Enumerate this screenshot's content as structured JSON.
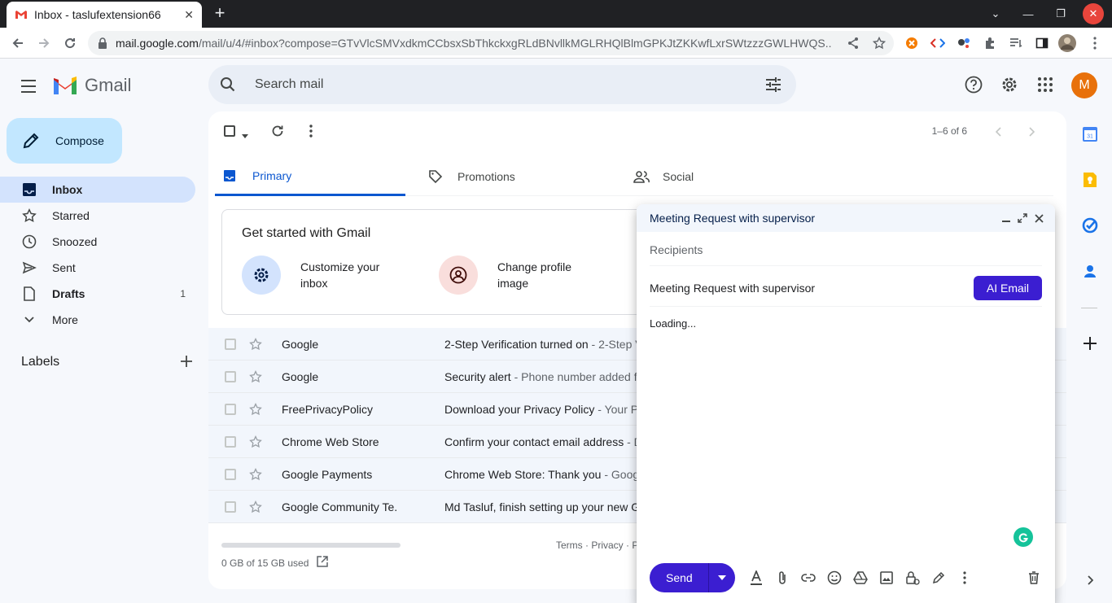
{
  "browser": {
    "tab_title": "Inbox - taslufextension66",
    "url_host": "mail.google.com",
    "url_path": "/mail/u/4/#inbox?compose=GTvVlcSMVxdkmCCbsxSbThkckxgRLdBNvllkMGLRHQlBlmGPKJtZKKwfLxrSWtzzzGWLHWQS..."
  },
  "gmail": {
    "brand": "Gmail",
    "search_placeholder": "Search mail",
    "avatar_letter": "M",
    "compose_label": "Compose"
  },
  "nav": {
    "items": [
      {
        "label": "Inbox",
        "count": ""
      },
      {
        "label": "Starred",
        "count": ""
      },
      {
        "label": "Snoozed",
        "count": ""
      },
      {
        "label": "Sent",
        "count": ""
      },
      {
        "label": "Drafts",
        "count": "1"
      },
      {
        "label": "More",
        "count": ""
      }
    ],
    "labels_heading": "Labels"
  },
  "main": {
    "pager": "1–6 of 6",
    "tabs": [
      "Primary",
      "Promotions",
      "Social"
    ],
    "get_started": {
      "title": "Get started with Gmail",
      "items": [
        "Customize your inbox",
        "Change profile image"
      ]
    },
    "emails": [
      {
        "sender": "Google",
        "subject": "2-Step Verification turned on",
        "snippet": " - 2-Step V"
      },
      {
        "sender": "Google",
        "subject": "Security alert",
        "snippet": " - Phone number added fo"
      },
      {
        "sender": "FreePrivacyPolicy",
        "subject": "Download your Privacy Policy",
        "snippet": " - Your Priv"
      },
      {
        "sender": "Chrome Web Store",
        "subject": "Confirm your contact email address",
        "snippet": " - D"
      },
      {
        "sender": "Google Payments",
        "subject": "Chrome Web Store: Thank you",
        "snippet": " - Google"
      },
      {
        "sender": "Google Community Te.",
        "subject": "Md Tasluf, finish setting up your new Go",
        "snippet": ""
      }
    ],
    "storage": "0 GB of 15 GB used",
    "terms": "Terms · Privacy · P"
  },
  "compose": {
    "title": "Meeting Request with supervisor",
    "recipients_placeholder": "Recipients",
    "subject": "Meeting Request with supervisor",
    "ai_button": "AI Email",
    "body": "Loading...",
    "send_label": "Send"
  },
  "colors": {
    "accent": "#0b57d0",
    "compose_accent": "#3b1ed1",
    "avatar": "#e8710a"
  }
}
